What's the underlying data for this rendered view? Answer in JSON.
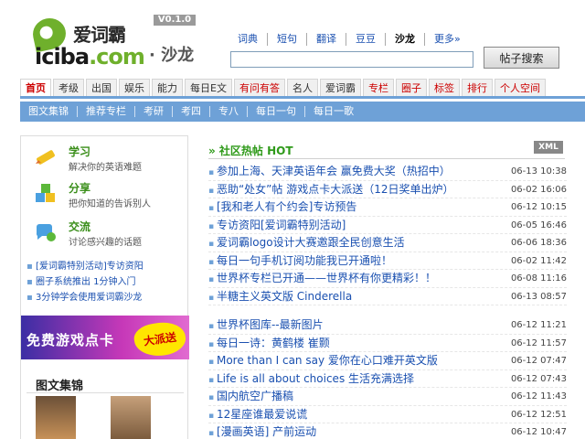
{
  "header": {
    "logo_cn": "爱词霸",
    "logo_en_a": "iciba",
    "logo_en_b": ".com",
    "version": "V0.1.0",
    "section": "· 沙龙",
    "topnav": [
      {
        "label": "词典"
      },
      {
        "label": "短句"
      },
      {
        "label": "翻译"
      },
      {
        "label": "豆豆"
      },
      {
        "label": "沙龙"
      },
      {
        "label": "更多»"
      }
    ],
    "search_placeholder": "",
    "search_button": "帖子搜索"
  },
  "mainnav": [
    {
      "label": "首页"
    },
    {
      "label": "考级"
    },
    {
      "label": "出国"
    },
    {
      "label": "娱乐"
    },
    {
      "label": "能力"
    },
    {
      "label": "每日E文"
    },
    {
      "label": "有问有答"
    },
    {
      "label": "名人"
    },
    {
      "label": "爱词霸"
    },
    {
      "label": "专栏"
    },
    {
      "label": "圈子"
    },
    {
      "label": "标签"
    },
    {
      "label": "排行"
    },
    {
      "label": "个人空间"
    }
  ],
  "subnav": [
    {
      "label": "图文集锦"
    },
    {
      "label": "推荐专栏"
    },
    {
      "label": "考研"
    },
    {
      "label": "考四"
    },
    {
      "label": "专八"
    },
    {
      "label": "每日一句"
    },
    {
      "label": "每日一歌"
    }
  ],
  "sidebar": {
    "services": [
      {
        "title": "学习",
        "desc": "解决你的英语难题"
      },
      {
        "title": "分享",
        "desc": "把你知道的告诉别人"
      },
      {
        "title": "交流",
        "desc": "讨论感兴趣的话题"
      }
    ],
    "links": [
      "[爱词霸特别活动]专访资阳",
      "圈子系统推出 1分钟入门",
      "3分钟学会使用爱词霸沙龙"
    ],
    "banner_text": "免费游戏点卡",
    "banner_badge": "大派送",
    "gallery_title": "图文集锦"
  },
  "content": {
    "hot_title": "» 社区热帖  HOT",
    "xml": "XML",
    "list1": [
      {
        "title": "参加上海、天津英语年会 赢免费大奖（热招中）",
        "date": "06-13 10:38"
      },
      {
        "title": "恶助“处女”帖 游戏点卡大派送（12日奖单出炉）",
        "date": "06-02 16:06"
      },
      {
        "title": "[我和老人有个约会]专访预告",
        "date": "06-12 10:15"
      },
      {
        "title": "专访资阳[爱词霸特别活动]",
        "date": "06-05 16:46"
      },
      {
        "title": "爱词霸logo设计大赛邀跟全民创意生活",
        "date": "06-06 18:36"
      },
      {
        "title": "每日一句手机订阅功能我已开通啦！",
        "date": "06-02 11:42"
      },
      {
        "title": "世界杯专栏已开通——世界杯有你更精彩！！",
        "date": "06-08 11:16"
      },
      {
        "title": "半糖主义英文版  Cinderella",
        "date": "06-13 08:57"
      }
    ],
    "list2": [
      {
        "title": "世界杯图库--最新图片",
        "date": "06-12 11:21"
      },
      {
        "title": "每日一诗：黄鹤楼 崔颢",
        "date": "06-12 11:57"
      },
      {
        "title": "More than I can say 爱你在心口难开英文版",
        "date": "06-12 07:47"
      },
      {
        "title": "Life is all about choices 生活充满选择",
        "date": "06-12 07:43"
      },
      {
        "title": "国内航空广播稿",
        "date": "06-12 11:43"
      },
      {
        "title": "12星座谁最爱说谎",
        "date": "06-12 12:51"
      },
      {
        "title": "[漫画英语] 产前运动",
        "date": "06-12 10:47"
      }
    ]
  },
  "colors": {
    "accent_blue": "#6ea1d7",
    "link_blue": "#1a50b0",
    "green": "#3a8e1a",
    "red": "#cc0000"
  }
}
